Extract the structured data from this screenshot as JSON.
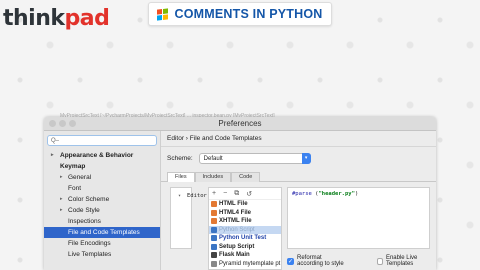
{
  "brand": {
    "part1": "think",
    "part2": "pad"
  },
  "banner": {
    "text": "COMMENTS IN PYTHON"
  },
  "window": {
    "title": "Preferences",
    "behind_text": "MyProjectSrcText [~/PycharmProjects/MyProjectSrcText] ... inspector.bean.py [MyProjectSrcText]"
  },
  "sidebar": {
    "search_placeholder": "Q–",
    "items": [
      {
        "label": "Appearance & Behavior",
        "arrow": "▸"
      },
      {
        "label": "Keymap",
        "arrow": ""
      },
      {
        "label": "Editor",
        "arrow": "▾"
      },
      {
        "label": "General",
        "arrow": "▸"
      },
      {
        "label": "Font",
        "arrow": ""
      },
      {
        "label": "Color Scheme",
        "arrow": "▸"
      },
      {
        "label": "Code Style",
        "arrow": "▸"
      },
      {
        "label": "Inspections",
        "arrow": ""
      },
      {
        "label": "File and Code Templates",
        "arrow": ""
      },
      {
        "label": "File Encodings",
        "arrow": ""
      },
      {
        "label": "Live Templates",
        "arrow": ""
      }
    ]
  },
  "main": {
    "breadcrumb": {
      "root": "Editor",
      "sep": "›",
      "leaf": "File and Code Templates"
    },
    "scheme_label": "Scheme:",
    "scheme_value": "Default",
    "tabs": [
      "Files",
      "Includes",
      "Code"
    ],
    "list_tools": [
      "+",
      "−",
      "⧉",
      "↺"
    ],
    "templates": [
      {
        "label": "HTML File",
        "color": "#e37933"
      },
      {
        "label": "HTML4 File",
        "color": "#e37933"
      },
      {
        "label": "XHTML File",
        "color": "#e37933"
      },
      {
        "label": "Python Script",
        "color": "#3b75c4"
      },
      {
        "label": "Python Unit Test",
        "color": "#3b75c4"
      },
      {
        "label": "Setup Script",
        "color": "#3b75c4"
      },
      {
        "label": "Flask Main",
        "color": "#444444"
      },
      {
        "label": "Pyramid mytemplate pt",
        "color": "#888888"
      }
    ],
    "editor_code": {
      "directive": "#parse",
      "open": " (",
      "arg": "\"header.py\"",
      "close": ")"
    },
    "reformat_label": "Reformat according to style",
    "live_label": "Enable Live Templates"
  }
}
